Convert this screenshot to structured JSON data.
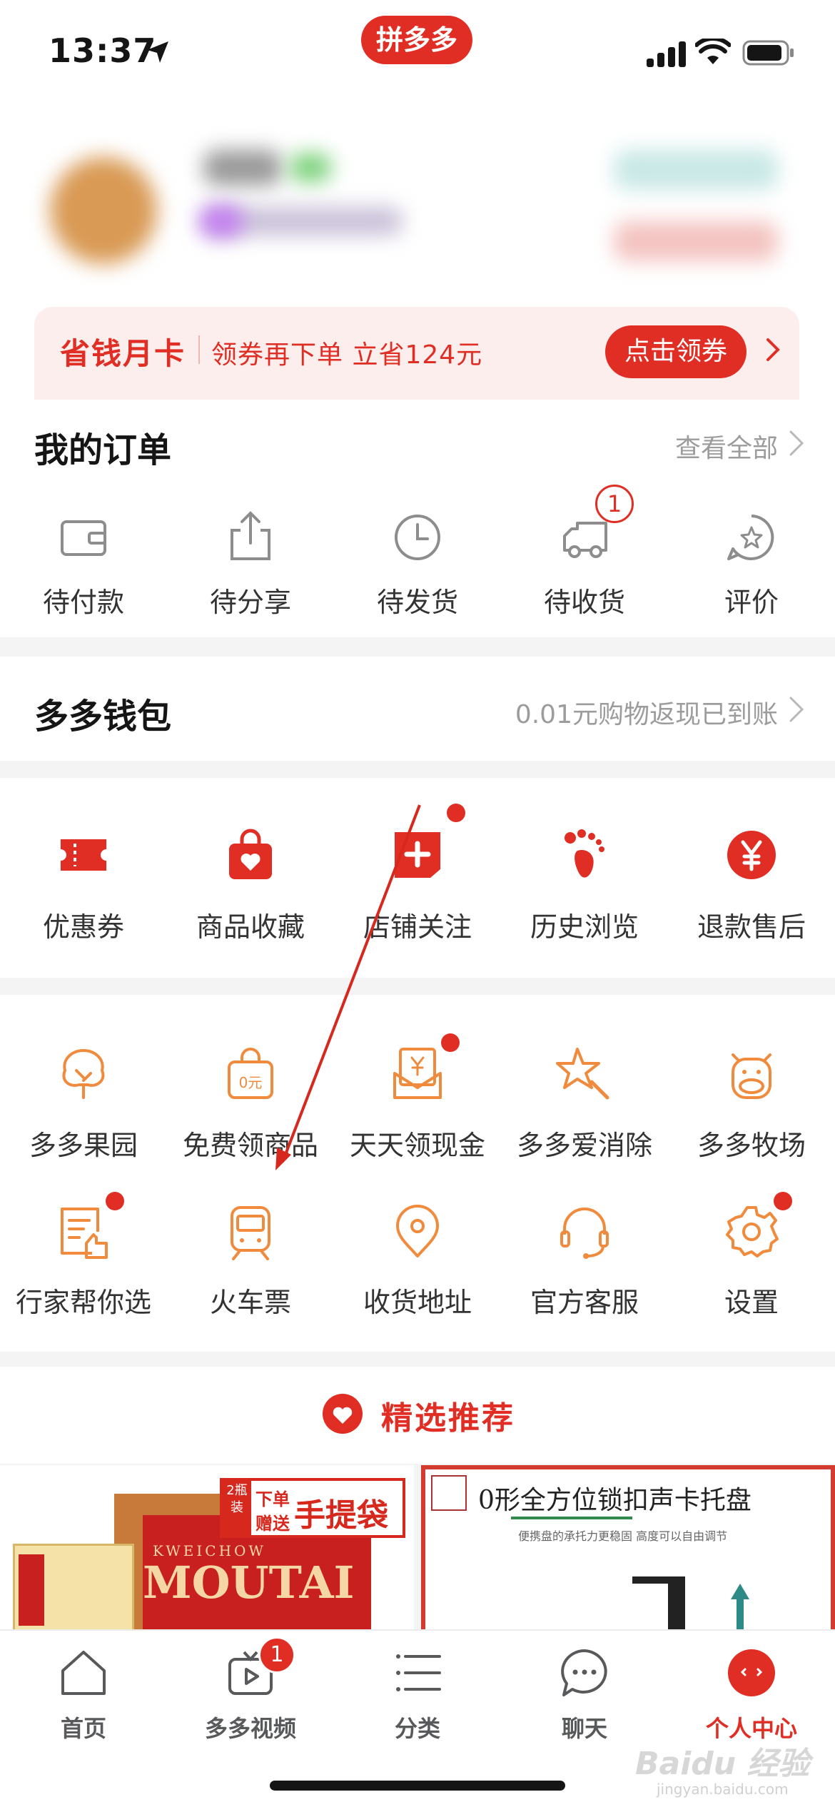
{
  "status_bar": {
    "time": "13:37",
    "brand": "拼多多"
  },
  "savings_card": {
    "title": "省钱月卡",
    "description": "领券再下单 立省124元",
    "button": "点击领券"
  },
  "orders": {
    "title": "我的订单",
    "view_all": "查看全部",
    "items": [
      {
        "label": "待付款",
        "icon": "wallet-icon"
      },
      {
        "label": "待分享",
        "icon": "share-icon"
      },
      {
        "label": "待发货",
        "icon": "clock-icon"
      },
      {
        "label": "待收货",
        "icon": "truck-icon",
        "badge": "1"
      },
      {
        "label": "评价",
        "icon": "review-star-icon"
      }
    ]
  },
  "wallet": {
    "title": "多多钱包",
    "note": "0.01元购物返现已到账"
  },
  "shortcuts": [
    {
      "label": "优惠券",
      "icon": "coupon-icon"
    },
    {
      "label": "商品收藏",
      "icon": "favorite-bag-icon"
    },
    {
      "label": "店铺关注",
      "icon": "store-follow-icon",
      "dot": true
    },
    {
      "label": "历史浏览",
      "icon": "footprint-icon"
    },
    {
      "label": "退款售后",
      "icon": "refund-yen-icon"
    }
  ],
  "services": [
    {
      "label": "多多果园",
      "icon": "tree-icon"
    },
    {
      "label": "免费领商品",
      "icon": "free-bag-icon"
    },
    {
      "label": "天天领现金",
      "icon": "cash-envelope-icon",
      "dot": true
    },
    {
      "label": "多多爱消除",
      "icon": "star-wand-icon"
    },
    {
      "label": "多多牧场",
      "icon": "cow-icon"
    },
    {
      "label": "行家帮你选",
      "icon": "expert-pick-icon",
      "dot": true
    },
    {
      "label": "火车票",
      "icon": "train-icon"
    },
    {
      "label": "收货地址",
      "icon": "location-pin-icon"
    },
    {
      "label": "官方客服",
      "icon": "headset-icon"
    },
    {
      "label": "设置",
      "icon": "settings-gear-icon",
      "dot": true
    }
  ],
  "recommend": {
    "title": "精选推荐"
  },
  "products": [
    {
      "banner_count": "2瓶装",
      "banner_top": "下单",
      "banner_bottom": "赠送",
      "banner_main": "手提袋",
      "brand": "MOUTAI",
      "brand_small": "KWEICHOW"
    },
    {
      "title": "0形全方位锁扣声卡托盘",
      "subtitle": "便携盘的承托力更稳固 高度可以自由调节"
    }
  ],
  "tabbar": [
    {
      "label": "首页",
      "icon": "home-icon"
    },
    {
      "label": "多多视频",
      "icon": "video-icon",
      "badge": "1"
    },
    {
      "label": "分类",
      "icon": "category-list-icon"
    },
    {
      "label": "聊天",
      "icon": "chat-icon"
    },
    {
      "label": "个人中心",
      "icon": "profile-icon",
      "active": true
    }
  ],
  "watermark": {
    "text": "Baidu 经验",
    "sub": "jingyan.baidu.com"
  },
  "colors": {
    "accent": "#e02e24",
    "service_orange": "#f08a3c",
    "text": "#151516",
    "muted": "#9c9c9c"
  }
}
